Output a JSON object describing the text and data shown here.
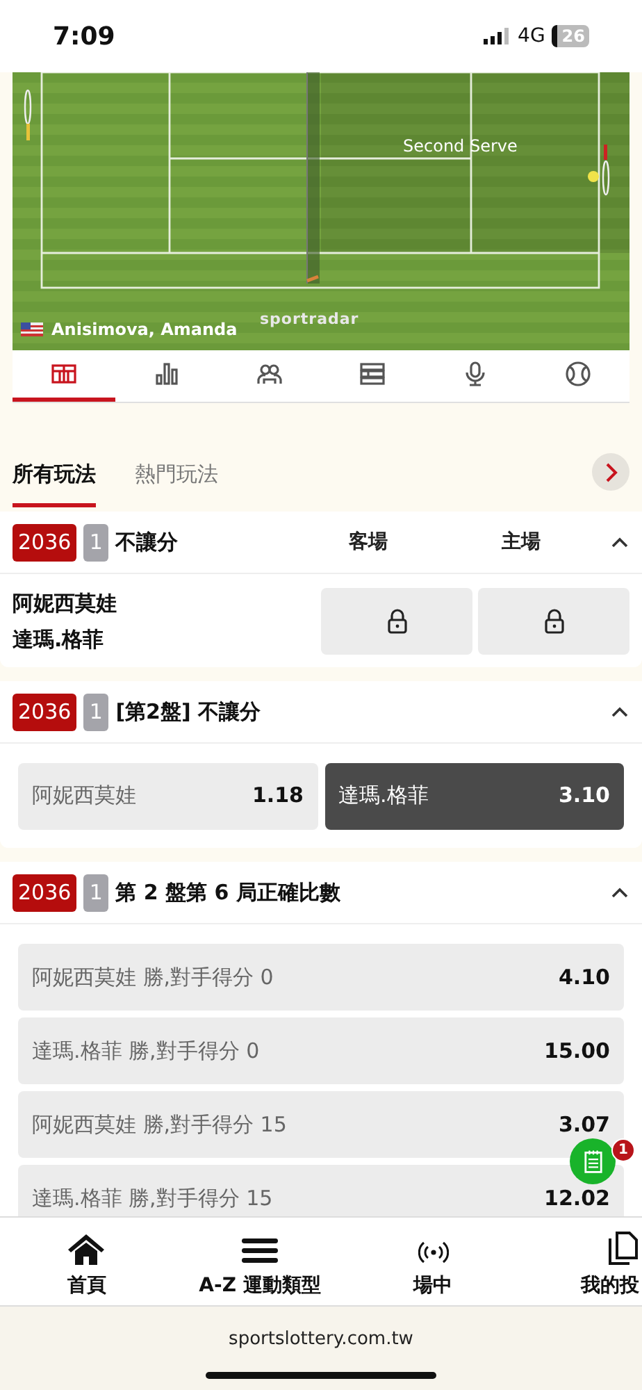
{
  "status_bar": {
    "time": "7:09",
    "network": "4G",
    "battery": "26"
  },
  "match_widget": {
    "status_text": "Second Serve",
    "player": "Anisimova, Amanda",
    "brand": "sportradar"
  },
  "view_tabs": [
    {
      "kind": "court",
      "selected": true
    },
    {
      "kind": "stats",
      "selected": false
    },
    {
      "kind": "players",
      "selected": false
    },
    {
      "kind": "list",
      "selected": false
    },
    {
      "kind": "commentary",
      "selected": false
    },
    {
      "kind": "ball",
      "selected": false
    }
  ],
  "market_tabs": [
    {
      "label": "所有玩法",
      "selected": true
    },
    {
      "label": "熱門玩法",
      "selected": false
    }
  ],
  "markets": [
    {
      "kind": "locked",
      "code": "2036",
      "number": "1",
      "title": "不讓分",
      "expanded": true,
      "columns": [
        "客場",
        "主場"
      ],
      "teams": [
        "阿妮西莫娃",
        "達瑪.格菲"
      ]
    },
    {
      "kind": "pair",
      "code": "2036",
      "number": "1",
      "title": "[第2盤] 不讓分",
      "expanded": true,
      "options": [
        {
          "label": "阿妮西莫娃",
          "odds": "1.18",
          "selected": false
        },
        {
          "label": "達瑪.格菲",
          "odds": "3.10",
          "selected": true
        }
      ]
    },
    {
      "kind": "list",
      "code": "2036",
      "number": "1",
      "title": "第 2 盤第 6 局正確比數",
      "expanded": true,
      "options": [
        {
          "label": "阿妮西莫娃 勝,對手得分 0",
          "odds": "4.10"
        },
        {
          "label": "達瑪.格菲 勝,對手得分 0",
          "odds": "15.00"
        },
        {
          "label": "阿妮西莫娃 勝,對手得分 15",
          "odds": "3.07"
        },
        {
          "label": "達瑪.格菲 勝,對手得分 15",
          "odds": "12.02"
        }
      ]
    }
  ],
  "bet_slip_badge": "1",
  "bottom_nav": [
    {
      "kind": "home",
      "label": "首頁"
    },
    {
      "kind": "menu",
      "label": "A-Z 運動類型"
    },
    {
      "kind": "live",
      "label": "場中"
    },
    {
      "kind": "bets",
      "label": "我的投"
    }
  ],
  "browser_url": "sportslottery.com.tw"
}
